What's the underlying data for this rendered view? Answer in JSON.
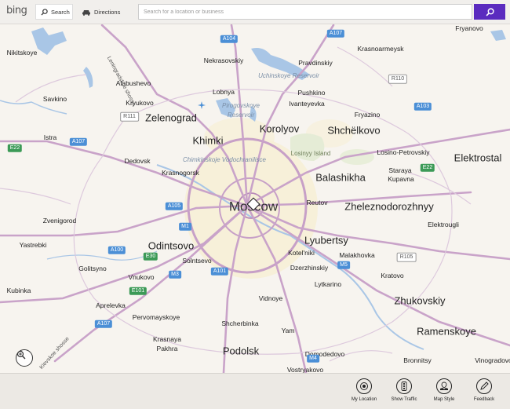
{
  "header": {
    "logo": "bing",
    "tab_search": "Search",
    "tab_directions": "Directions",
    "search_placeholder": "Search for a location or business"
  },
  "map": {
    "cities": {
      "moscow": "Moscow",
      "zelenograd": "Zelenograd",
      "khimki": "Khimki",
      "korolyov": "Korolyov",
      "shchelkovo": "Shchëlkovo",
      "balashikha": "Balashikha",
      "zheleznodorozhny": "Zheleznodorozhnyy",
      "elektrostal": "Elektrostal",
      "lyubertsy": "Lyubertsy",
      "odintsovo": "Odintsovo",
      "zhukovskiy": "Zhukovskiy",
      "ramenskoye": "Ramenskoye",
      "podolsk": "Podolsk"
    },
    "towns": {
      "fryanovo": "Fryanovo",
      "nikitskoye": "Nikitskoye",
      "krasnoarmeysk": "Krasnoarmeysk",
      "nekrasovskiy": "Nekrasovskiy",
      "pravdinskiy": "Pravdinskiy",
      "alabushevo": "Alabushevo",
      "lobnya": "Lobnya",
      "savkino": "Savkino",
      "pushkino": "Pushkino",
      "kryukovo": "Kryukovo",
      "ivanteyevka": "Ivanteyevka",
      "fryazino": "Fryazino",
      "istra": "Istra",
      "losino": "Losino-Petrovskiy",
      "dedovsk": "Dedovsk",
      "krasnogorsk": "Krasnogorsk",
      "staraya": "Staraya",
      "kupavna": "Kupavna",
      "reutov": "Reutov",
      "zvenigorod": "Zvenigorod",
      "elektrougli": "Elektrougli",
      "yastrebki": "Yastrebki",
      "kotelniki": "Kotel'niki",
      "malakhovka": "Malakhovka",
      "solntsevo": "Solntsevo",
      "golitsyno": "Golitsyno",
      "vnukovo": "Vnukovo",
      "dzerzhinskiy": "Dzerzhinskiy",
      "kratovo": "Kratovo",
      "lytkarino": "Lytkarino",
      "kubinka": "Kubinka",
      "vidnoye": "Vidnoye",
      "aprelevka": "Aprelevka",
      "pervomayskoye": "Pervomayskoye",
      "shcherbinka": "Shcherbinka",
      "yam": "Yam",
      "krasnaya_pakhra_1": "Krasnaya",
      "krasnaya_pakhra_2": "Pakhra",
      "domodedovo": "Domodedovo",
      "bronnitsy": "Bronnitsy",
      "vinogradovo": "Vinogradovo",
      "vostryakovo": "Vostryakovo"
    },
    "water": {
      "uchinskoye": "Uchinskoye Reservoir",
      "pirogovskoye_1": "Pirogovskoye",
      "pirogovskoye_2": "Reservoir",
      "chimkinskoye": "Chimkinskoje Vodochranilisce"
    },
    "green": {
      "losiny": "Losinyy Island"
    },
    "roads": {
      "leningradskoe": "Leningradskoe shosse",
      "kievskoe": "Kievskoe shosse"
    },
    "shields": {
      "a104": "A104",
      "a107_n": "A107",
      "r110": "R110",
      "a103": "A103",
      "r111": "R111",
      "e22_w": "E22",
      "a107_w": "A107",
      "e22_e": "E22",
      "a105": "A105",
      "m1": "M1",
      "a100": "A100",
      "e30": "E30",
      "m3": "M3",
      "a101": "A101",
      "m5": "M5",
      "r105": "R105",
      "e101": "E101",
      "a107_s": "A107",
      "m4": "M4"
    }
  },
  "appbar": {
    "my_location": "My Location",
    "show_traffic": "Show Traffic",
    "map_style": "Map Style",
    "feedback": "Feedback"
  }
}
